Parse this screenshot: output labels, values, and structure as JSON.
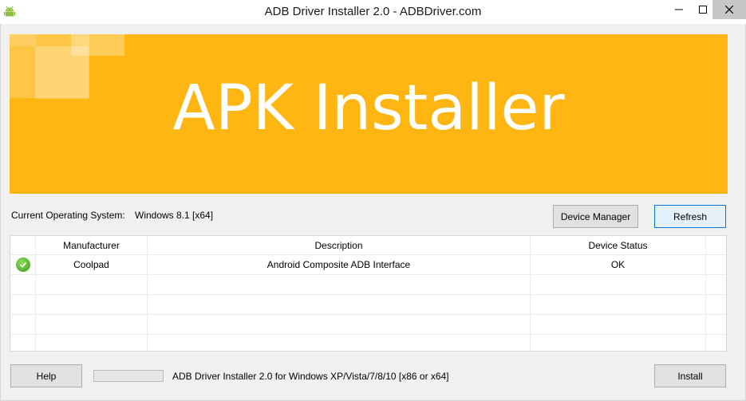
{
  "window": {
    "title": "ADB Driver Installer 2.0 - ADBDriver.com",
    "icon": "android-icon"
  },
  "banner": {
    "text": "APK Installer",
    "color": "#ffb612"
  },
  "os": {
    "label": "Current Operating System:",
    "value": "Windows 8.1  [x64]"
  },
  "buttons": {
    "device_manager": "Device Manager",
    "refresh": "Refresh",
    "help": "Help",
    "install": "Install"
  },
  "table": {
    "columns": [
      "",
      "Manufacturer",
      "Description",
      "Device Status",
      ""
    ],
    "rows": [
      {
        "status_icon": "check-icon",
        "manufacturer": "Coolpad",
        "description": "Android Composite ADB Interface",
        "device_status": "OK"
      }
    ]
  },
  "progress": {
    "fraction": 0
  },
  "status_text": "ADB Driver Installer 2.0 for Windows XP/Vista/7/8/10 [x86 or x64]"
}
